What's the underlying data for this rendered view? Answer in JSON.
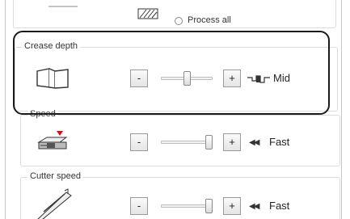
{
  "top_group": {
    "radio_label": "Process all"
  },
  "crease_depth": {
    "title": "Crease depth",
    "minus_label": "-",
    "plus_label": "+",
    "value_label": "Mid",
    "level": 0.5
  },
  "feed_speed": {
    "title": "Speed",
    "minus_label": "-",
    "plus_label": "+",
    "speed_glyph": "◀◀",
    "value_label": "Fast",
    "level": 1.0
  },
  "cutter_speed": {
    "title": "Cutter speed",
    "minus_label": "-",
    "plus_label": "+",
    "speed_glyph": "◀◀",
    "value_label": "Fast",
    "level": 1.0
  }
}
